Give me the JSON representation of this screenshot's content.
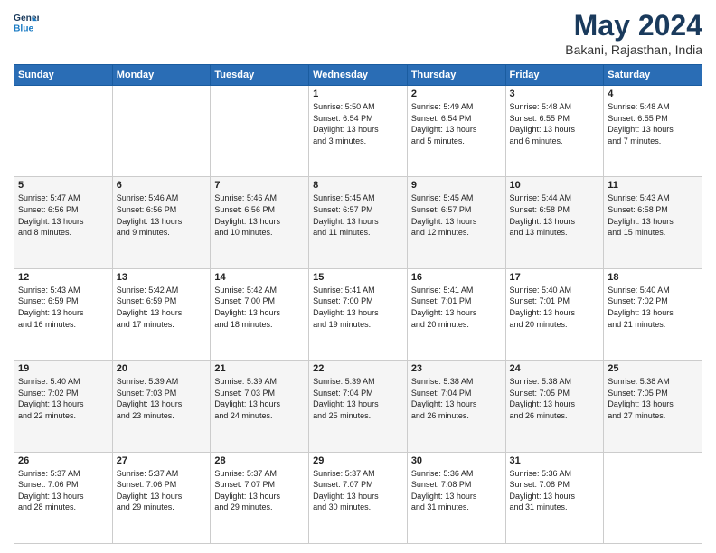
{
  "logo": {
    "line1": "General",
    "line2": "Blue"
  },
  "title": "May 2024",
  "location": "Bakani, Rajasthan, India",
  "days_of_week": [
    "Sunday",
    "Monday",
    "Tuesday",
    "Wednesday",
    "Thursday",
    "Friday",
    "Saturday"
  ],
  "weeks": [
    [
      {
        "day": "",
        "info": ""
      },
      {
        "day": "",
        "info": ""
      },
      {
        "day": "",
        "info": ""
      },
      {
        "day": "1",
        "info": "Sunrise: 5:50 AM\nSunset: 6:54 PM\nDaylight: 13 hours\nand 3 minutes."
      },
      {
        "day": "2",
        "info": "Sunrise: 5:49 AM\nSunset: 6:54 PM\nDaylight: 13 hours\nand 5 minutes."
      },
      {
        "day": "3",
        "info": "Sunrise: 5:48 AM\nSunset: 6:55 PM\nDaylight: 13 hours\nand 6 minutes."
      },
      {
        "day": "4",
        "info": "Sunrise: 5:48 AM\nSunset: 6:55 PM\nDaylight: 13 hours\nand 7 minutes."
      }
    ],
    [
      {
        "day": "5",
        "info": "Sunrise: 5:47 AM\nSunset: 6:56 PM\nDaylight: 13 hours\nand 8 minutes."
      },
      {
        "day": "6",
        "info": "Sunrise: 5:46 AM\nSunset: 6:56 PM\nDaylight: 13 hours\nand 9 minutes."
      },
      {
        "day": "7",
        "info": "Sunrise: 5:46 AM\nSunset: 6:56 PM\nDaylight: 13 hours\nand 10 minutes."
      },
      {
        "day": "8",
        "info": "Sunrise: 5:45 AM\nSunset: 6:57 PM\nDaylight: 13 hours\nand 11 minutes."
      },
      {
        "day": "9",
        "info": "Sunrise: 5:45 AM\nSunset: 6:57 PM\nDaylight: 13 hours\nand 12 minutes."
      },
      {
        "day": "10",
        "info": "Sunrise: 5:44 AM\nSunset: 6:58 PM\nDaylight: 13 hours\nand 13 minutes."
      },
      {
        "day": "11",
        "info": "Sunrise: 5:43 AM\nSunset: 6:58 PM\nDaylight: 13 hours\nand 15 minutes."
      }
    ],
    [
      {
        "day": "12",
        "info": "Sunrise: 5:43 AM\nSunset: 6:59 PM\nDaylight: 13 hours\nand 16 minutes."
      },
      {
        "day": "13",
        "info": "Sunrise: 5:42 AM\nSunset: 6:59 PM\nDaylight: 13 hours\nand 17 minutes."
      },
      {
        "day": "14",
        "info": "Sunrise: 5:42 AM\nSunset: 7:00 PM\nDaylight: 13 hours\nand 18 minutes."
      },
      {
        "day": "15",
        "info": "Sunrise: 5:41 AM\nSunset: 7:00 PM\nDaylight: 13 hours\nand 19 minutes."
      },
      {
        "day": "16",
        "info": "Sunrise: 5:41 AM\nSunset: 7:01 PM\nDaylight: 13 hours\nand 20 minutes."
      },
      {
        "day": "17",
        "info": "Sunrise: 5:40 AM\nSunset: 7:01 PM\nDaylight: 13 hours\nand 20 minutes."
      },
      {
        "day": "18",
        "info": "Sunrise: 5:40 AM\nSunset: 7:02 PM\nDaylight: 13 hours\nand 21 minutes."
      }
    ],
    [
      {
        "day": "19",
        "info": "Sunrise: 5:40 AM\nSunset: 7:02 PM\nDaylight: 13 hours\nand 22 minutes."
      },
      {
        "day": "20",
        "info": "Sunrise: 5:39 AM\nSunset: 7:03 PM\nDaylight: 13 hours\nand 23 minutes."
      },
      {
        "day": "21",
        "info": "Sunrise: 5:39 AM\nSunset: 7:03 PM\nDaylight: 13 hours\nand 24 minutes."
      },
      {
        "day": "22",
        "info": "Sunrise: 5:39 AM\nSunset: 7:04 PM\nDaylight: 13 hours\nand 25 minutes."
      },
      {
        "day": "23",
        "info": "Sunrise: 5:38 AM\nSunset: 7:04 PM\nDaylight: 13 hours\nand 26 minutes."
      },
      {
        "day": "24",
        "info": "Sunrise: 5:38 AM\nSunset: 7:05 PM\nDaylight: 13 hours\nand 26 minutes."
      },
      {
        "day": "25",
        "info": "Sunrise: 5:38 AM\nSunset: 7:05 PM\nDaylight: 13 hours\nand 27 minutes."
      }
    ],
    [
      {
        "day": "26",
        "info": "Sunrise: 5:37 AM\nSunset: 7:06 PM\nDaylight: 13 hours\nand 28 minutes."
      },
      {
        "day": "27",
        "info": "Sunrise: 5:37 AM\nSunset: 7:06 PM\nDaylight: 13 hours\nand 29 minutes."
      },
      {
        "day": "28",
        "info": "Sunrise: 5:37 AM\nSunset: 7:07 PM\nDaylight: 13 hours\nand 29 minutes."
      },
      {
        "day": "29",
        "info": "Sunrise: 5:37 AM\nSunset: 7:07 PM\nDaylight: 13 hours\nand 30 minutes."
      },
      {
        "day": "30",
        "info": "Sunrise: 5:36 AM\nSunset: 7:08 PM\nDaylight: 13 hours\nand 31 minutes."
      },
      {
        "day": "31",
        "info": "Sunrise: 5:36 AM\nSunset: 7:08 PM\nDaylight: 13 hours\nand 31 minutes."
      },
      {
        "day": "",
        "info": ""
      }
    ]
  ]
}
